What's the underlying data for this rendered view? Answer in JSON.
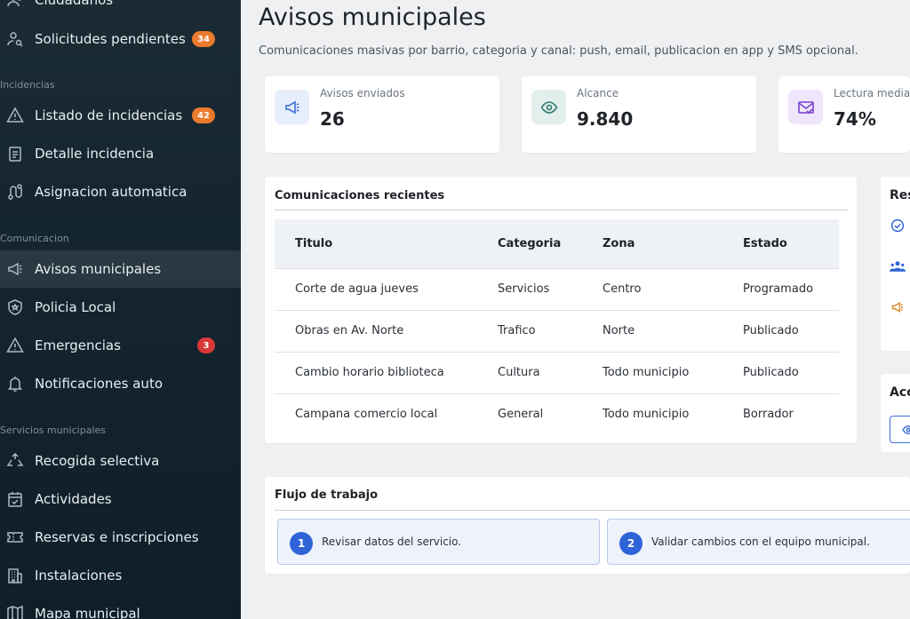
{
  "sidebar": {
    "items": [
      {
        "label": "Ciudadanos"
      },
      {
        "label": "Solicitudes pendientes",
        "badge": "34"
      },
      {
        "label": "Listado de incidencias",
        "badge": "42"
      },
      {
        "label": "Detalle incidencia"
      },
      {
        "label": "Asignacion automatica"
      },
      {
        "label": "Avisos municipales"
      },
      {
        "label": "Policia Local"
      },
      {
        "label": "Emergencias",
        "badge": "3"
      },
      {
        "label": "Notificaciones auto"
      },
      {
        "label": "Recogida selectiva"
      },
      {
        "label": "Actividades"
      },
      {
        "label": "Reservas e inscripciones"
      },
      {
        "label": "Instalaciones"
      },
      {
        "label": "Mapa municipal"
      }
    ],
    "sections": {
      "incidencias": "Incidencias",
      "comunicacion": "Comunicacion",
      "servicios": "Servicios municipales"
    }
  },
  "page": {
    "title": "Avisos municipales",
    "subtitle": "Comunicaciones masivas por barrio, categoria y canal: push, email, publicacion en app y SMS opcional."
  },
  "stats": [
    {
      "label": "Avisos enviados",
      "value": "26",
      "icon": "megaphone-icon",
      "color": "#3b6fd8",
      "bg": "#e6edfb"
    },
    {
      "label": "Alcance",
      "value": "9.840",
      "icon": "eye-icon",
      "color": "#2f7a6a",
      "bg": "#e2efec"
    },
    {
      "label": "Lectura media",
      "value": "74%",
      "icon": "mail-check-icon",
      "color": "#7a3fd0",
      "bg": "#efe6fb"
    }
  ],
  "recent": {
    "title": "Comunicaciones recientes",
    "columns": [
      "Titulo",
      "Categoria",
      "Zona",
      "Estado"
    ],
    "rows": [
      [
        "Corte de agua jueves",
        "Servicios",
        "Centro",
        "Programado"
      ],
      [
        "Obras en Av. Norte",
        "Trafico",
        "Norte",
        "Publicado"
      ],
      [
        "Cambio horario biblioteca",
        "Cultura",
        "Todo municipio",
        "Publicado"
      ],
      [
        "Campana comercio local",
        "General",
        "Todo municipio",
        "Borrador"
      ]
    ]
  },
  "side": {
    "res_title": "Res",
    "acc_title": "Acc"
  },
  "workflow": {
    "title": "Flujo de trabajo",
    "steps": [
      {
        "num": "1",
        "text": "Revisar datos del servicio."
      },
      {
        "num": "2",
        "text": "Validar cambios con el equipo municipal."
      }
    ]
  },
  "colors": {
    "sidebar_bg": "#142530",
    "badge_orange": "#ea7a2e",
    "badge_red": "#d93838",
    "accent_blue": "#2f63d8"
  }
}
